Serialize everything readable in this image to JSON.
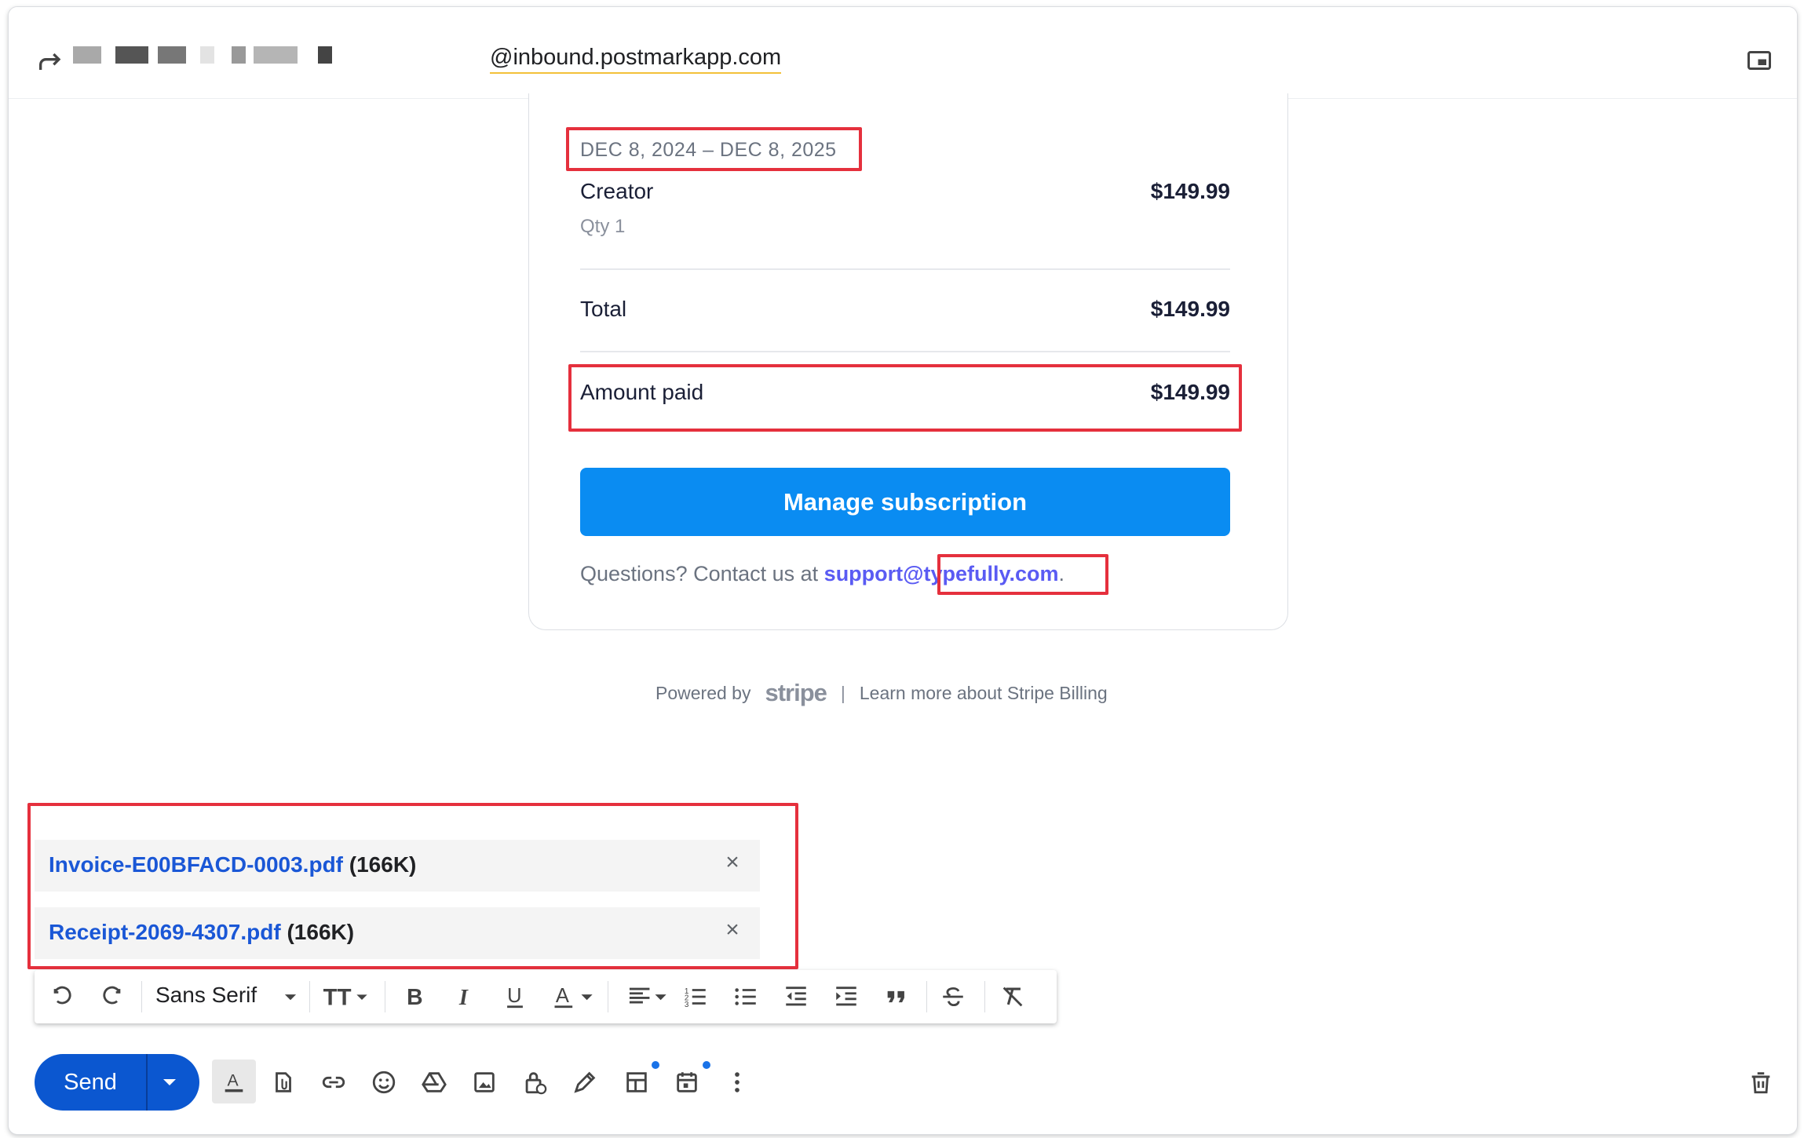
{
  "header": {
    "to_address": "@inbound.postmarkapp.com"
  },
  "receipt": {
    "date_range": "DEC 8, 2024 – DEC 8, 2025",
    "item_name": "Creator",
    "item_price": "$149.99",
    "item_qty": "Qty 1",
    "total_label": "Total",
    "total_value": "$149.99",
    "paid_label": "Amount paid",
    "paid_value": "$149.99",
    "manage_button": "Manage subscription",
    "questions_text": "Questions? Contact us at ",
    "support_email": "support@typefully.com",
    "questions_end": "."
  },
  "footer": {
    "powered_by": "Powered by",
    "stripe": "stripe",
    "separator": "|",
    "learn_more": "Learn more about Stripe Billing"
  },
  "attachments": [
    {
      "name": "Invoice-E00BFACD-0003.pdf",
      "size": "(166K)"
    },
    {
      "name": "Receipt-2069-4307.pdf",
      "size": "(166K)"
    }
  ],
  "formatting": {
    "font": "Sans Serif"
  },
  "compose": {
    "send_label": "Send"
  },
  "colors": {
    "highlight": "#e5303d",
    "send_button": "#0b57d0",
    "manage_button": "#0a8cf2",
    "link": "#5a5bf3",
    "attachment_link": "#1a57d6"
  }
}
